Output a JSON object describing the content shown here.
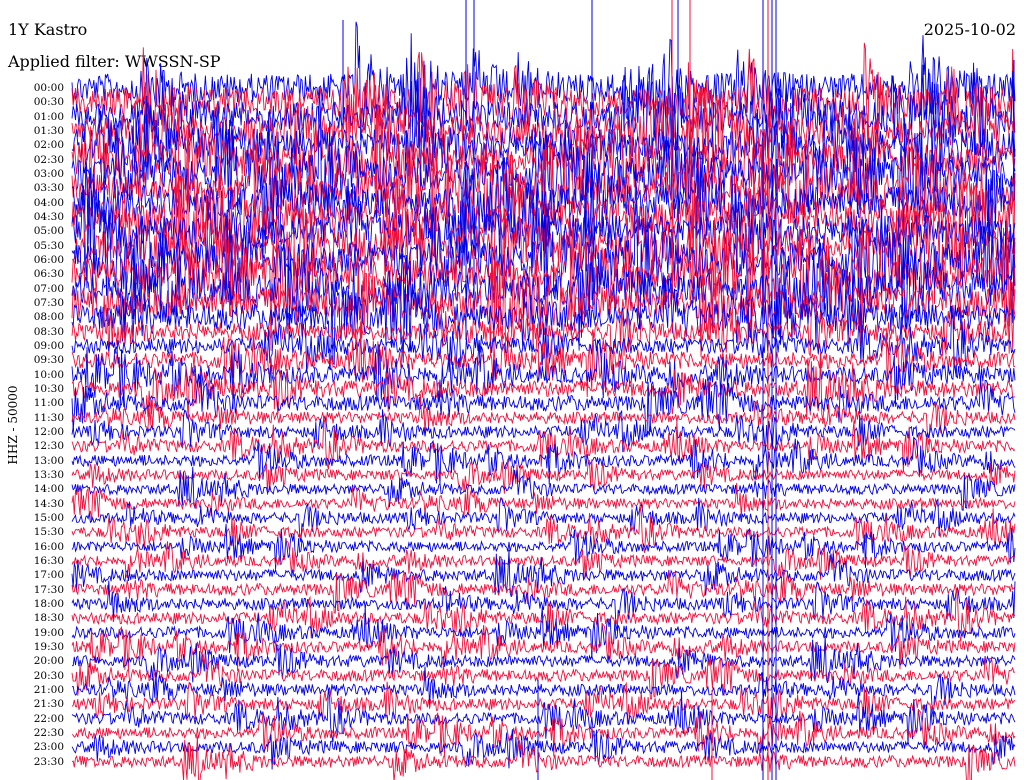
{
  "header": {
    "station": "1Y Kastro",
    "date": "2025-10-02",
    "filter": "Applied filter: WWSSN-SP"
  },
  "chart_data": {
    "type": "line",
    "title": "1Y Kastro",
    "ylabel": "HHZ - 50000",
    "row_labels": [
      "00:00",
      "00:30",
      "01:00",
      "01:30",
      "02:00",
      "02:30",
      "03:00",
      "03:30",
      "04:00",
      "04:30",
      "05:00",
      "05:30",
      "06:00",
      "06:30",
      "07:00",
      "07:30",
      "08:00",
      "08:30",
      "09:00",
      "09:30",
      "10:00",
      "10:30",
      "11:00",
      "11:30",
      "12:00",
      "12:30",
      "13:00",
      "13:30",
      "14:00",
      "14:30",
      "15:00",
      "15:30",
      "16:00",
      "16:30",
      "17:00",
      "17:30",
      "18:00",
      "18:30",
      "19:00",
      "19:30",
      "20:00",
      "20:30",
      "21:00",
      "21:30",
      "22:00",
      "22:30",
      "23:00",
      "23:30"
    ],
    "row_minutes": 30,
    "series_colors": [
      "#0000e8",
      "#f0103c"
    ],
    "amplitude_relative": [
      2.2,
      2.2,
      2.3,
      2.3,
      2.5,
      2.5,
      2.6,
      2.6,
      2.6,
      2.6,
      2.5,
      2.6,
      2.7,
      2.7,
      2.5,
      2.4,
      2.0,
      1.4,
      1.2,
      1.3,
      1.3,
      1.3,
      1.2,
      0.9,
      0.9,
      0.9,
      0.9,
      0.8,
      0.8,
      0.8,
      0.8,
      0.8,
      0.8,
      0.8,
      0.9,
      0.9,
      0.9,
      0.9,
      0.9,
      0.9,
      0.9,
      0.9,
      0.9,
      0.9,
      0.9,
      0.9,
      0.9,
      0.9
    ],
    "grid": false,
    "legend": "none"
  }
}
